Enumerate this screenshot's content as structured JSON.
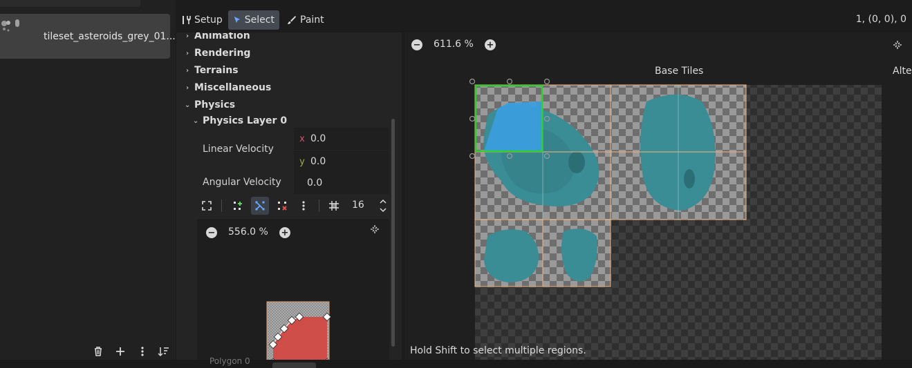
{
  "left_panel": {
    "tileset_name": "tileset_asteroids_grey_01....",
    "toolbar_icons": [
      "trash-icon",
      "add-icon",
      "more-vertical-icon",
      "sort-icon"
    ]
  },
  "toolbar": {
    "modes": [
      {
        "label": "Setup",
        "icon": "setup-tools-icon",
        "active": false
      },
      {
        "label": "Select",
        "icon": "pointer-icon",
        "active": true
      },
      {
        "label": "Paint",
        "icon": "brush-icon",
        "active": false
      }
    ],
    "coords": "1, (0, 0), 0"
  },
  "inspector": {
    "sections": [
      {
        "label": "Animation",
        "expanded": false
      },
      {
        "label": "Rendering",
        "expanded": false
      },
      {
        "label": "Terrains",
        "expanded": false
      },
      {
        "label": "Miscellaneous",
        "expanded": false
      },
      {
        "label": "Physics",
        "expanded": true
      }
    ],
    "physics_layer": {
      "label": "Physics Layer 0",
      "linear_velocity": {
        "label": "Linear Velocity",
        "x_axis": "x",
        "x": "0.0",
        "y_axis": "y",
        "y": "0.0"
      },
      "angular_velocity": {
        "label": "Angular Velocity",
        "value": "0.0"
      }
    },
    "polygon_editor": {
      "grid_value": "16",
      "zoom": "556.0 %",
      "fill_color": "#d4453f"
    }
  },
  "atlas": {
    "zoom": "611.6 %",
    "title": "Base Tiles",
    "alt_title": "Alte",
    "status": "Hold Shift to select multiple regions.",
    "selection_color": "#33cc33",
    "tile_border_color": "#e8b080",
    "asteroid_color": "#3a8c95",
    "collision_overlay_color": "#3b9ee0"
  },
  "bottom": {
    "partial_label": "Polygon 0"
  }
}
